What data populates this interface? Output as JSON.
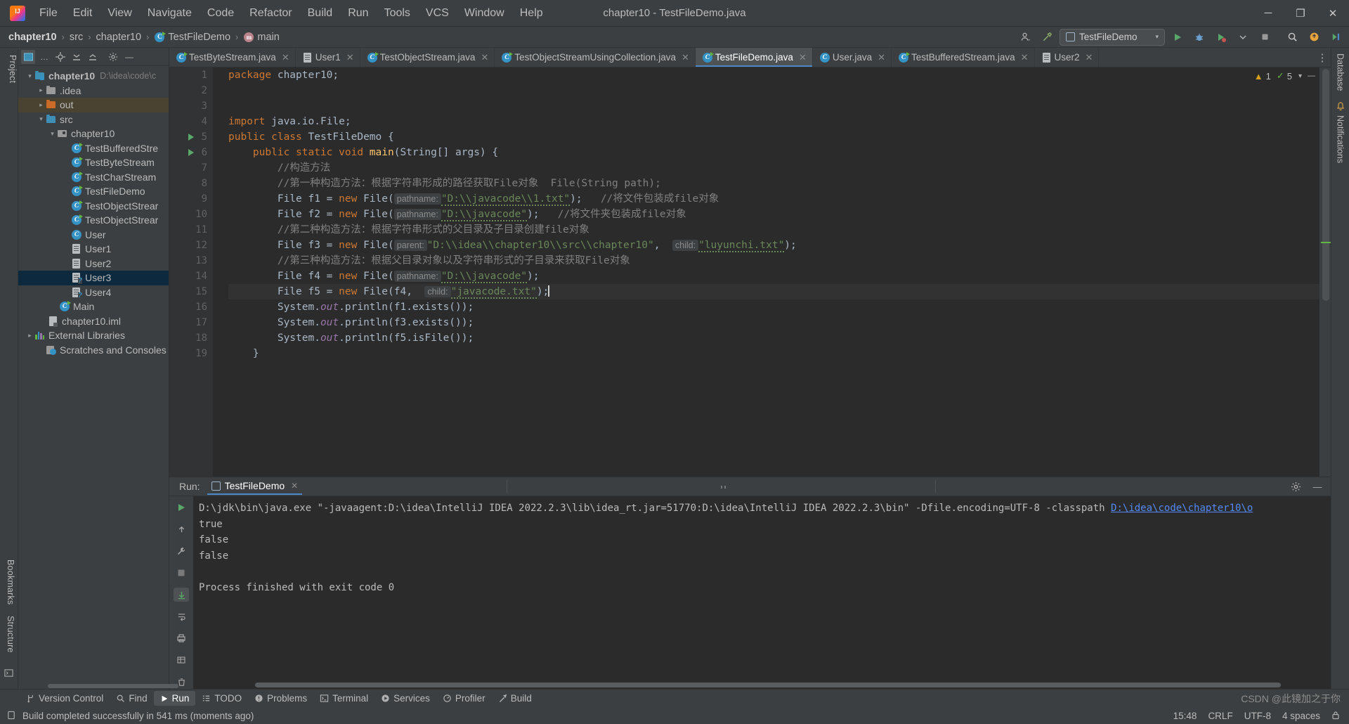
{
  "window": {
    "title": "chapter10 - TestFileDemo.java",
    "logo_icon": "intellij-idea-logo",
    "minimize_glyph": "─",
    "maximize_glyph": "❐",
    "close_glyph": "✕"
  },
  "menubar": {
    "items": [
      {
        "label": "File"
      },
      {
        "label": "Edit"
      },
      {
        "label": "View"
      },
      {
        "label": "Navigate"
      },
      {
        "label": "Code"
      },
      {
        "label": "Refactor"
      },
      {
        "label": "Build"
      },
      {
        "label": "Run"
      },
      {
        "label": "Tools"
      },
      {
        "label": "VCS"
      },
      {
        "label": "Window"
      },
      {
        "label": "Help"
      }
    ]
  },
  "navbar": {
    "crumbs": [
      {
        "label": "chapter10",
        "icon": ""
      },
      {
        "label": "src",
        "icon": ""
      },
      {
        "label": "chapter10",
        "icon": ""
      },
      {
        "label": "TestFileDemo",
        "icon": "class-icon"
      },
      {
        "label": "main",
        "icon": "method-icon"
      }
    ],
    "separator": "›",
    "run_config": "TestFileDemo",
    "icons": {
      "profile": "user-profile-icon",
      "hammer": "build-hammer-icon",
      "run": "run-icon",
      "debug": "debug-icon",
      "run_coverage": "run-with-coverage-icon",
      "more_run": "chevron-down-icon",
      "stop": "stop-icon",
      "search": "search-everywhere-icon",
      "updates": "updates-icon",
      "ide_tools": "ide-and-project-settings-icon"
    }
  },
  "left_rail": {
    "top_label": "Project",
    "bottom_labels": [
      "Bookmarks",
      "Structure"
    ]
  },
  "right_rail": {
    "labels": [
      "Database",
      "Notifications"
    ]
  },
  "project_pane": {
    "toolbar_icons": [
      "project-view-selector",
      "more-options",
      "locate-icon",
      "expand-all-icon",
      "collapse-all-icon",
      "settings-gear-icon",
      "hide-icon"
    ],
    "tree": [
      {
        "label": "chapter10",
        "path": "D:\\idea\\code\\c",
        "icon": "module-folder-icon",
        "depth": 0,
        "arrow": "down",
        "bold": true,
        "state": "normal"
      },
      {
        "label": ".idea",
        "path": "",
        "icon": "folder-icon",
        "depth": 1,
        "arrow": "right",
        "bold": false,
        "state": "normal"
      },
      {
        "label": "out",
        "path": "",
        "icon": "excluded-folder-icon",
        "depth": 1,
        "arrow": "right",
        "bold": false,
        "state": "selected-dim"
      },
      {
        "label": "src",
        "path": "",
        "icon": "source-folder-icon",
        "depth": 1,
        "arrow": "down",
        "bold": false,
        "state": "normal"
      },
      {
        "label": "chapter10",
        "path": "",
        "icon": "package-icon",
        "depth": 2,
        "arrow": "down",
        "bold": false,
        "state": "normal"
      },
      {
        "label": "TestBufferedStre",
        "path": "",
        "icon": "runnable-class-icon",
        "depth": 3,
        "arrow": "",
        "bold": false,
        "state": "normal"
      },
      {
        "label": "TestByteStream",
        "path": "",
        "icon": "runnable-class-icon",
        "depth": 3,
        "arrow": "",
        "bold": false,
        "state": "normal"
      },
      {
        "label": "TestCharStream",
        "path": "",
        "icon": "runnable-class-icon",
        "depth": 3,
        "arrow": "",
        "bold": false,
        "state": "normal"
      },
      {
        "label": "TestFileDemo",
        "path": "",
        "icon": "runnable-class-icon",
        "depth": 3,
        "arrow": "",
        "bold": false,
        "state": "normal"
      },
      {
        "label": "TestObjectStrear",
        "path": "",
        "icon": "runnable-class-icon",
        "depth": 3,
        "arrow": "",
        "bold": false,
        "state": "normal"
      },
      {
        "label": "TestObjectStrear",
        "path": "",
        "icon": "runnable-class-icon",
        "depth": 3,
        "arrow": "",
        "bold": false,
        "state": "normal"
      },
      {
        "label": "User",
        "path": "",
        "icon": "class-icon",
        "depth": 3,
        "arrow": "",
        "bold": false,
        "state": "normal"
      },
      {
        "label": "User1",
        "path": "",
        "icon": "file-icon",
        "depth": 3,
        "arrow": "",
        "bold": false,
        "state": "normal"
      },
      {
        "label": "User2",
        "path": "",
        "icon": "file-icon",
        "depth": 3,
        "arrow": "",
        "bold": false,
        "state": "normal"
      },
      {
        "label": "User3",
        "path": "",
        "icon": "unknown-file-icon",
        "depth": 3,
        "arrow": "",
        "bold": false,
        "state": "selected-focus"
      },
      {
        "label": "User4",
        "path": "",
        "icon": "unknown-file-icon",
        "depth": 3,
        "arrow": "",
        "bold": false,
        "state": "normal"
      },
      {
        "label": "Main",
        "path": "",
        "icon": "class-icon",
        "depth": 2,
        "arrow": "",
        "bold": false,
        "state": "normal"
      },
      {
        "label": "chapter10.iml",
        "path": "",
        "icon": "iml-file-icon",
        "depth": 1,
        "arrow": "",
        "bold": false,
        "state": "normal"
      },
      {
        "label": "External Libraries",
        "path": "",
        "icon": "libraries-icon",
        "depth": 0,
        "arrow": "right",
        "bold": false,
        "state": "normal"
      },
      {
        "label": "Scratches and Consoles",
        "path": "",
        "icon": "scratches-icon",
        "depth": 0,
        "arrow": "",
        "bold": false,
        "state": "normal"
      }
    ]
  },
  "editor": {
    "tabs": [
      {
        "label": "TestByteStream.java",
        "icon": "runnable-class-icon",
        "active": false,
        "closable": true
      },
      {
        "label": "User1",
        "icon": "file-icon",
        "active": false,
        "closable": true
      },
      {
        "label": "TestObjectStream.java",
        "icon": "runnable-class-icon",
        "active": false,
        "closable": true
      },
      {
        "label": "TestObjectStreamUsingCollection.java",
        "icon": "runnable-class-icon",
        "active": false,
        "closable": true
      },
      {
        "label": "TestFileDemo.java",
        "icon": "runnable-class-icon",
        "active": true,
        "closable": true
      },
      {
        "label": "User.java",
        "icon": "class-icon",
        "active": false,
        "closable": true
      },
      {
        "label": "TestBufferedStream.java",
        "icon": "runnable-class-icon",
        "active": false,
        "closable": true
      },
      {
        "label": "User2",
        "icon": "file-icon",
        "active": false,
        "closable": true
      }
    ],
    "inspection": {
      "warnings": "1",
      "checks": "5",
      "warning_icon": "warning-triangle-icon",
      "ok_icon": "checkmark-icon"
    },
    "lines": [
      {
        "no": "1",
        "runmark": false
      },
      {
        "no": "2",
        "runmark": false
      },
      {
        "no": "3",
        "runmark": false
      },
      {
        "no": "4",
        "runmark": false
      },
      {
        "no": "5",
        "runmark": true
      },
      {
        "no": "6",
        "runmark": true
      },
      {
        "no": "7",
        "runmark": false
      },
      {
        "no": "8",
        "runmark": false
      },
      {
        "no": "9",
        "runmark": false
      },
      {
        "no": "10",
        "runmark": false
      },
      {
        "no": "11",
        "runmark": false
      },
      {
        "no": "12",
        "runmark": false
      },
      {
        "no": "13",
        "runmark": false
      },
      {
        "no": "14",
        "runmark": false
      },
      {
        "no": "15",
        "runmark": false
      },
      {
        "no": "16",
        "runmark": false
      },
      {
        "no": "17",
        "runmark": false
      },
      {
        "no": "18",
        "runmark": false
      },
      {
        "no": "19",
        "runmark": false
      }
    ],
    "code": {
      "l1_kw": "package",
      "l1_name": " chapter10;",
      "l4_kw": "import",
      "l4_name": " java.io.File;",
      "l5_kw": "public class",
      "l5_name": " TestFileDemo {",
      "l6_kw": "public static void",
      "l6_mth": " main",
      "l6_rest": "(String[] args) {",
      "l7_cmt": "//构造方法",
      "l8_cmt": "//第一种构造方法：根据字符串形成的路径获取File对象  File(String path);",
      "l9_decl": "File f1 = ",
      "l9_new": "new",
      "l9_ctor": " File(",
      "l9_hint": "pathname:",
      "l9_str": "\"D:\\\\javacode\\\\1.txt\"",
      "l9_tail": ");",
      "l9_cmt": "//将文件包装成file对象",
      "l10_decl": "File f2 = ",
      "l10_hint": "pathname:",
      "l10_str": "\"D:\\\\javacode\"",
      "l10_cmt": "//将文件夹包装成file对象",
      "l11_cmt": "//第二种构造方法：根据字符串形式的父目录及子目录创建file对象",
      "l12_decl": "File f3 = ",
      "l12_hint1": "parent:",
      "l12_str1": "\"D:\\\\idea\\\\chapter10\\\\src\\\\chapter10\"",
      "l12_hint2": "child:",
      "l12_str2": "\"luyunchi.txt\"",
      "l13_cmt": "//第三种构造方法：根据父目录对象以及字符串形式的子目录来获取File对象",
      "l14_decl": "File f4 = ",
      "l14_hint": "pathname:",
      "l14_str": "\"D:\\\\javacode\"",
      "l15_decl": "File f5 = ",
      "l15_ctor": " File(f4, ",
      "l15_hint": "child:",
      "l15_str": "\"javacode.txt\"",
      "l16": "System.out.println(f1.exists());",
      "l17": "System.out.println(f3.exists());",
      "l18": "System.out.println(f5.isFile());",
      "l19": "}",
      "sys": "System.",
      "out": "out",
      "println": ".println(",
      "f1call": "f1.exists()",
      "f3call": "f3.exists()",
      "f5call": "f5.isFile()",
      "close": ");"
    }
  },
  "run_window": {
    "label": "Run:",
    "tab": "TestFileDemo",
    "close_glyph": "✕",
    "settings_icon": "settings-gear-icon",
    "hide_icon": "hide-icon",
    "side_icons": [
      "rerun-icon",
      "scroll-up-icon",
      "wrench-icon",
      "stop-icon",
      "scroll-down-stack-icon",
      "soft-wrap-icon",
      "scroll-to-end-icon",
      "print-icon",
      "table-icon",
      "trash-icon"
    ],
    "console": {
      "cmd_prefix": "D:\\jdk\\bin\\java.exe \"-javaagent:D:\\idea\\IntelliJ IDEA 2022.2.3\\lib\\idea_rt.jar=51770:D:\\idea\\IntelliJ IDEA 2022.2.3\\bin\" -Dfile.encoding=UTF-8 -classpath ",
      "cmd_link": "D:\\idea\\code\\chapter10\\o",
      "out1": "true",
      "out2": "false",
      "out3": "false",
      "out4": "",
      "exit": "Process finished with exit code 0"
    }
  },
  "bottom_stripe": {
    "items": [
      {
        "label": "Version Control",
        "icon": "branch-icon",
        "active": false
      },
      {
        "label": "Find",
        "icon": "search-icon",
        "active": false
      },
      {
        "label": "Run",
        "icon": "run-icon",
        "active": true
      },
      {
        "label": "TODO",
        "icon": "todo-list-icon",
        "active": false
      },
      {
        "label": "Problems",
        "icon": "problems-icon",
        "active": false
      },
      {
        "label": "Terminal",
        "icon": "terminal-icon",
        "active": false
      },
      {
        "label": "Services",
        "icon": "services-icon",
        "active": false
      },
      {
        "label": "Profiler",
        "icon": "profiler-icon",
        "active": false
      },
      {
        "label": "Build",
        "icon": "build-icon",
        "active": false
      }
    ]
  },
  "statusbar": {
    "message": "Build completed successfully in 541 ms (moments ago)",
    "message_icon": "build-status-icon",
    "time": "15:48",
    "position": "CRLF",
    "encoding": "UTF-8",
    "indent": "4 spaces",
    "lock_icon": "lock-icon",
    "watermark": "CSDN @此镜加之于你"
  }
}
